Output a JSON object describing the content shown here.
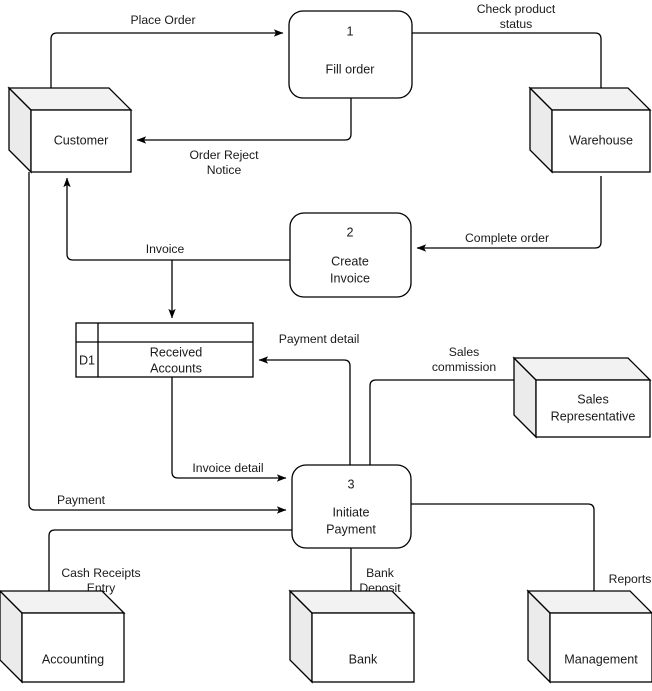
{
  "diagram": {
    "title": "Order and Payment Data Flow Diagram",
    "type": "data-flow-diagram",
    "background_color": "#ffffff",
    "line_color": "#000000",
    "entity_fill": "#ffffff",
    "entity_shade": "#ebebeb"
  },
  "entities": [
    {
      "id": "customer",
      "label": "Customer"
    },
    {
      "id": "warehouse",
      "label": "Warehouse"
    },
    {
      "id": "sales_rep",
      "label_line1": "Sales",
      "label_line2": "Representative"
    },
    {
      "id": "accounting",
      "label": "Accounting"
    },
    {
      "id": "bank",
      "label": "Bank"
    },
    {
      "id": "management",
      "label": "Management"
    }
  ],
  "processes": [
    {
      "id": "p1",
      "number": "1",
      "name_line1": "Fill order",
      "name_line2": ""
    },
    {
      "id": "p2",
      "number": "2",
      "name_line1": "Create",
      "name_line2": "Invoice"
    },
    {
      "id": "p3",
      "number": "3",
      "name_line1": "Initiate",
      "name_line2": "Payment"
    }
  ],
  "datastores": [
    {
      "id": "d1",
      "code": "D1",
      "name_line1": "Received",
      "name_line2": "Accounts"
    }
  ],
  "flows": [
    {
      "id": "place_order",
      "label": "Place Order",
      "label_line1": "Place Order",
      "label_line2": "",
      "from": "customer",
      "to": "p1"
    },
    {
      "id": "check_product_status",
      "label": "Check product status",
      "label_line1": "Check product",
      "label_line2": "status",
      "from": "p1",
      "to": "warehouse"
    },
    {
      "id": "order_reject_notice",
      "label": "Order Reject Notice",
      "label_line1": "Order Reject",
      "label_line2": "Notice",
      "from": "p1",
      "to": "customer"
    },
    {
      "id": "complete_order",
      "label": "Complete order",
      "label_line1": "Complete order",
      "label_line2": "",
      "from": "warehouse",
      "to": "p2"
    },
    {
      "id": "invoice",
      "label": "Invoice",
      "label_line1": "Invoice",
      "label_line2": "",
      "from": "p2",
      "to": "customer"
    },
    {
      "id": "payment_detail",
      "label": "Payment detail",
      "label_line1": "Payment detail",
      "label_line2": "",
      "from": "p3",
      "to": "d1"
    },
    {
      "id": "sales_commission",
      "label": "Sales commission",
      "label_line1": "Sales",
      "label_line2": "commission",
      "from": "p3",
      "to": "sales_rep"
    },
    {
      "id": "invoice_detail",
      "label": "Invoice detail",
      "label_line1": "Invoice detail",
      "label_line2": "",
      "from": "d1",
      "to": "p3"
    },
    {
      "id": "payment",
      "label": "Payment",
      "label_line1": "Payment",
      "label_line2": "",
      "from": "customer",
      "to": "p3"
    },
    {
      "id": "cash_receipts_entry",
      "label": "Cash Receipts Entry",
      "label_line1": "Cash Receipts",
      "label_line2": "Entry",
      "from": "p3",
      "to": "accounting"
    },
    {
      "id": "bank_deposit",
      "label": "Bank Deposit",
      "label_line1": "Bank",
      "label_line2": "Deposit",
      "from": "p3",
      "to": "bank"
    },
    {
      "id": "reports",
      "label": "Reports",
      "label_line1": "Reports",
      "label_line2": "",
      "from": "p3",
      "to": "management"
    }
  ]
}
